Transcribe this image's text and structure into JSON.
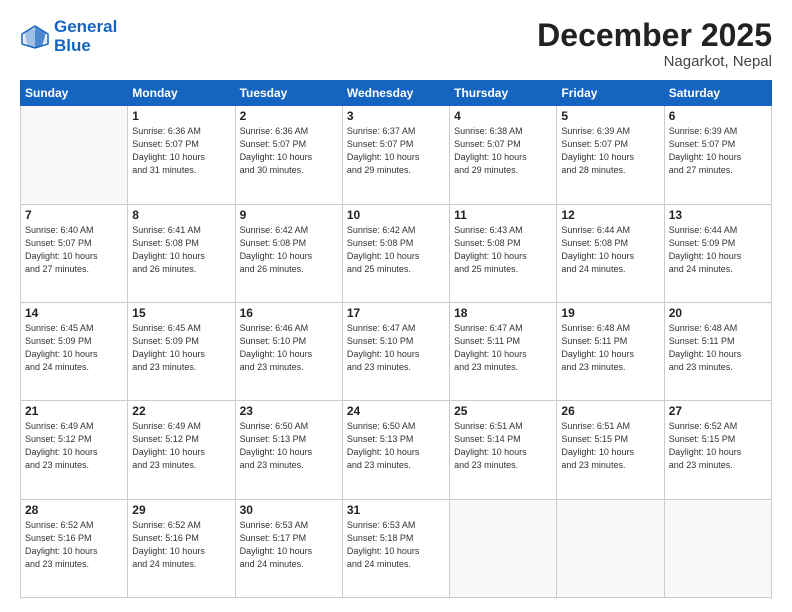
{
  "logo": {
    "line1": "General",
    "line2": "Blue"
  },
  "header": {
    "month": "December 2025",
    "location": "Nagarkot, Nepal"
  },
  "days_of_week": [
    "Sunday",
    "Monday",
    "Tuesday",
    "Wednesday",
    "Thursday",
    "Friday",
    "Saturday"
  ],
  "weeks": [
    [
      {
        "day": "",
        "info": ""
      },
      {
        "day": "1",
        "info": "Sunrise: 6:36 AM\nSunset: 5:07 PM\nDaylight: 10 hours\nand 31 minutes."
      },
      {
        "day": "2",
        "info": "Sunrise: 6:36 AM\nSunset: 5:07 PM\nDaylight: 10 hours\nand 30 minutes."
      },
      {
        "day": "3",
        "info": "Sunrise: 6:37 AM\nSunset: 5:07 PM\nDaylight: 10 hours\nand 29 minutes."
      },
      {
        "day": "4",
        "info": "Sunrise: 6:38 AM\nSunset: 5:07 PM\nDaylight: 10 hours\nand 29 minutes."
      },
      {
        "day": "5",
        "info": "Sunrise: 6:39 AM\nSunset: 5:07 PM\nDaylight: 10 hours\nand 28 minutes."
      },
      {
        "day": "6",
        "info": "Sunrise: 6:39 AM\nSunset: 5:07 PM\nDaylight: 10 hours\nand 27 minutes."
      }
    ],
    [
      {
        "day": "7",
        "info": "Sunrise: 6:40 AM\nSunset: 5:07 PM\nDaylight: 10 hours\nand 27 minutes."
      },
      {
        "day": "8",
        "info": "Sunrise: 6:41 AM\nSunset: 5:08 PM\nDaylight: 10 hours\nand 26 minutes."
      },
      {
        "day": "9",
        "info": "Sunrise: 6:42 AM\nSunset: 5:08 PM\nDaylight: 10 hours\nand 26 minutes."
      },
      {
        "day": "10",
        "info": "Sunrise: 6:42 AM\nSunset: 5:08 PM\nDaylight: 10 hours\nand 25 minutes."
      },
      {
        "day": "11",
        "info": "Sunrise: 6:43 AM\nSunset: 5:08 PM\nDaylight: 10 hours\nand 25 minutes."
      },
      {
        "day": "12",
        "info": "Sunrise: 6:44 AM\nSunset: 5:08 PM\nDaylight: 10 hours\nand 24 minutes."
      },
      {
        "day": "13",
        "info": "Sunrise: 6:44 AM\nSunset: 5:09 PM\nDaylight: 10 hours\nand 24 minutes."
      }
    ],
    [
      {
        "day": "14",
        "info": "Sunrise: 6:45 AM\nSunset: 5:09 PM\nDaylight: 10 hours\nand 24 minutes."
      },
      {
        "day": "15",
        "info": "Sunrise: 6:45 AM\nSunset: 5:09 PM\nDaylight: 10 hours\nand 23 minutes."
      },
      {
        "day": "16",
        "info": "Sunrise: 6:46 AM\nSunset: 5:10 PM\nDaylight: 10 hours\nand 23 minutes."
      },
      {
        "day": "17",
        "info": "Sunrise: 6:47 AM\nSunset: 5:10 PM\nDaylight: 10 hours\nand 23 minutes."
      },
      {
        "day": "18",
        "info": "Sunrise: 6:47 AM\nSunset: 5:11 PM\nDaylight: 10 hours\nand 23 minutes."
      },
      {
        "day": "19",
        "info": "Sunrise: 6:48 AM\nSunset: 5:11 PM\nDaylight: 10 hours\nand 23 minutes."
      },
      {
        "day": "20",
        "info": "Sunrise: 6:48 AM\nSunset: 5:11 PM\nDaylight: 10 hours\nand 23 minutes."
      }
    ],
    [
      {
        "day": "21",
        "info": "Sunrise: 6:49 AM\nSunset: 5:12 PM\nDaylight: 10 hours\nand 23 minutes."
      },
      {
        "day": "22",
        "info": "Sunrise: 6:49 AM\nSunset: 5:12 PM\nDaylight: 10 hours\nand 23 minutes."
      },
      {
        "day": "23",
        "info": "Sunrise: 6:50 AM\nSunset: 5:13 PM\nDaylight: 10 hours\nand 23 minutes."
      },
      {
        "day": "24",
        "info": "Sunrise: 6:50 AM\nSunset: 5:13 PM\nDaylight: 10 hours\nand 23 minutes."
      },
      {
        "day": "25",
        "info": "Sunrise: 6:51 AM\nSunset: 5:14 PM\nDaylight: 10 hours\nand 23 minutes."
      },
      {
        "day": "26",
        "info": "Sunrise: 6:51 AM\nSunset: 5:15 PM\nDaylight: 10 hours\nand 23 minutes."
      },
      {
        "day": "27",
        "info": "Sunrise: 6:52 AM\nSunset: 5:15 PM\nDaylight: 10 hours\nand 23 minutes."
      }
    ],
    [
      {
        "day": "28",
        "info": "Sunrise: 6:52 AM\nSunset: 5:16 PM\nDaylight: 10 hours\nand 23 minutes."
      },
      {
        "day": "29",
        "info": "Sunrise: 6:52 AM\nSunset: 5:16 PM\nDaylight: 10 hours\nand 24 minutes."
      },
      {
        "day": "30",
        "info": "Sunrise: 6:53 AM\nSunset: 5:17 PM\nDaylight: 10 hours\nand 24 minutes."
      },
      {
        "day": "31",
        "info": "Sunrise: 6:53 AM\nSunset: 5:18 PM\nDaylight: 10 hours\nand 24 minutes."
      },
      {
        "day": "",
        "info": ""
      },
      {
        "day": "",
        "info": ""
      },
      {
        "day": "",
        "info": ""
      }
    ]
  ]
}
